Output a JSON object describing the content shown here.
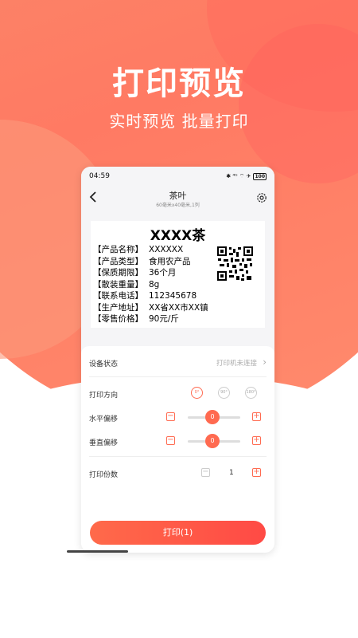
{
  "promo": {
    "headline": "打印预览",
    "subline": "实时预览  批量打印"
  },
  "statusbar": {
    "time": "04:59",
    "icons": "✱ ⁴ᴳ ⌔ ✈",
    "battery": "100"
  },
  "nav": {
    "title": "茶叶",
    "subtitle": "60毫米x40毫米,1列"
  },
  "label": {
    "title": "XXXX茶",
    "rows": [
      {
        "k": "【产品名称】",
        "v": "XXXXXX"
      },
      {
        "k": "【产品类型】",
        "v": "食用农产品"
      },
      {
        "k": "【保质期限】",
        "v": "36个月"
      },
      {
        "k": "【散装重量】",
        "v": "8g"
      },
      {
        "k": "【联系电话】",
        "v": "112345678"
      },
      {
        "k": "【生产地址】",
        "v": "XX省XX市XX镇"
      },
      {
        "k": "【零售价格】",
        "v": "90元/斤"
      }
    ]
  },
  "settings": {
    "device_status_label": "设备状态",
    "device_status_value": "打印机未连接",
    "orientation_label": "打印方向",
    "orientation_options": [
      "0°",
      "90°",
      "180°"
    ],
    "horizontal_label": "水平偏移",
    "horizontal_value": "0",
    "vertical_label": "垂直偏移",
    "vertical_value": "0",
    "copies_label": "打印份数",
    "copies_value": "1",
    "minus": "−",
    "plus": "+",
    "chevron": "›"
  },
  "print_button": "打印(1)",
  "colors": {
    "accent": "#ff6a50",
    "background": "#ff7a63"
  }
}
